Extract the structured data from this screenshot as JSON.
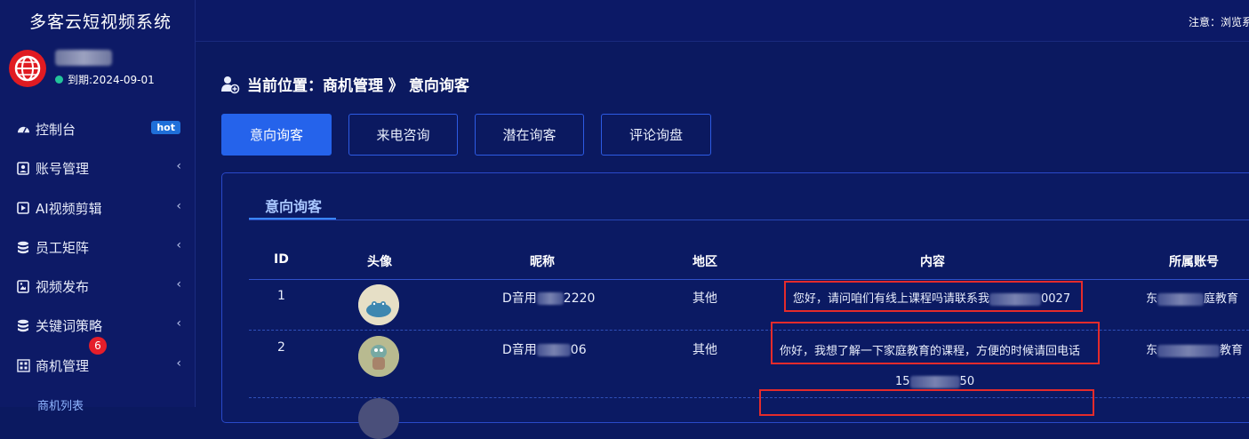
{
  "app": {
    "title": "多客云短视频系统",
    "expire": "到期:2024-09-01"
  },
  "topbar": {
    "notice": "注意：浏览系"
  },
  "sidebar": {
    "items": [
      {
        "label": "控制台",
        "icon": "dashboard-icon",
        "badge": "hot"
      },
      {
        "label": "账号管理",
        "icon": "account-icon"
      },
      {
        "label": "AI视频剪辑",
        "icon": "video-edit-icon"
      },
      {
        "label": "员工矩阵",
        "icon": "database-icon"
      },
      {
        "label": "视频发布",
        "icon": "publish-icon"
      },
      {
        "label": "关键词策略",
        "icon": "keyword-icon"
      },
      {
        "label": "商机管理",
        "icon": "business-icon",
        "count": "6"
      }
    ],
    "sub_item": "商机列表"
  },
  "breadcrumb": {
    "text": "当前位置：商机管理 》 意向询客"
  },
  "tabs": [
    "意向询客",
    "来电咨询",
    "潜在询客",
    "评论询盘"
  ],
  "panel": {
    "tab": "意向询客"
  },
  "table": {
    "columns": [
      "ID",
      "头像",
      "昵称",
      "地区",
      "内容",
      "所属账号"
    ],
    "rows": [
      {
        "id": "1",
        "nick_a": "D音用",
        "nick_b": "2220",
        "region": "其他",
        "content_a": "您好，请问咱们有线上课程吗请联系我",
        "content_b": "0027",
        "account_a": "东",
        "account_b": "庭教育"
      },
      {
        "id": "2",
        "nick_a": "D音用",
        "nick_b": "06",
        "region": "其他",
        "content_a": "你好，我想了解一下家庭教育的课程，方便的时候请回电话",
        "content_extra_a": "15",
        "content_extra_b": "50",
        "account_a": "东",
        "account_b": "教育"
      }
    ]
  },
  "colors": {
    "background": "#0b1960",
    "accent": "#2563eb",
    "highlight": "#e52b2b"
  }
}
